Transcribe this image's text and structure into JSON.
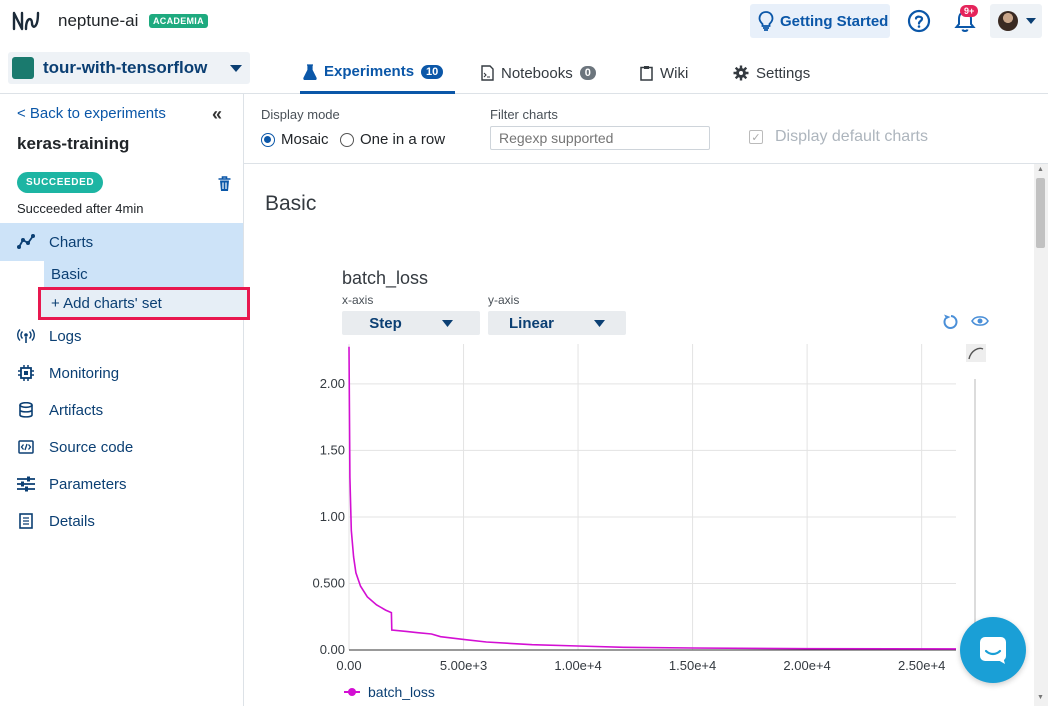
{
  "app": {
    "brand": "neptune-ai",
    "plan_badge": "ACADEMIA"
  },
  "header": {
    "getting_started": "Getting Started",
    "notifications_badge": "9+"
  },
  "project": {
    "name": "tour-with-tensorflow",
    "color": "#1a7a6e"
  },
  "tabs": [
    {
      "label": "Experiments",
      "count": "10",
      "active": true,
      "icon": "flask-icon"
    },
    {
      "label": "Notebooks",
      "count": "0",
      "active": false,
      "icon": "notebook-icon"
    },
    {
      "label": "Wiki",
      "active": false,
      "icon": "clipboard-icon"
    },
    {
      "label": "Settings",
      "active": false,
      "icon": "gear-icon"
    }
  ],
  "sidebar": {
    "back_link": "< Back to experiments",
    "experiment_name": "keras-training",
    "status": "SUCCEEDED",
    "status_text": "Succeeded after 4min",
    "charts_label": "Charts",
    "sub_items": [
      "Basic",
      "+ Add charts' set"
    ],
    "items": [
      {
        "label": "Logs",
        "icon": "antenna-icon"
      },
      {
        "label": "Monitoring",
        "icon": "chip-icon"
      },
      {
        "label": "Artifacts",
        "icon": "database-icon"
      },
      {
        "label": "Source code",
        "icon": "code-icon"
      },
      {
        "label": "Parameters",
        "icon": "sliders-icon"
      },
      {
        "label": "Details",
        "icon": "document-icon"
      }
    ]
  },
  "toolbar": {
    "display_mode_label": "Display mode",
    "mode_options": [
      "Mosaic",
      "One in a row"
    ],
    "selected_mode": "Mosaic",
    "filter_label": "Filter charts",
    "filter_placeholder": "Regexp supported",
    "default_charts_label": "Display default charts"
  },
  "main": {
    "section_title": "Basic",
    "chart": {
      "title": "batch_loss",
      "x_axis_label": "x-axis",
      "x_axis_value": "Step",
      "y_axis_label": "y-axis",
      "y_axis_value": "Linear"
    }
  },
  "chart_data": {
    "type": "line",
    "title": "batch_loss",
    "xlabel": "",
    "ylabel": "",
    "xlim": [
      0,
      26500
    ],
    "ylim": [
      0,
      2.3
    ],
    "x_ticks": [
      "0.00",
      "5.00e+3",
      "1.00e+4",
      "1.50e+4",
      "2.00e+4",
      "2.50e+4"
    ],
    "y_ticks": [
      "0.00",
      "0.500",
      "1.00",
      "1.50",
      "2.00"
    ],
    "grid": true,
    "legend_position": "bottom-left",
    "series": [
      {
        "name": "batch_loss",
        "color": "#d30fd3",
        "x": [
          0,
          40,
          100,
          200,
          300,
          500,
          800,
          1200,
          1600,
          1850,
          1870,
          2500,
          3000,
          3600,
          4000,
          5000,
          6000,
          8000,
          10000,
          12000,
          15000,
          20000,
          26500
        ],
        "y": [
          2.28,
          1.3,
          0.9,
          0.7,
          0.58,
          0.48,
          0.4,
          0.34,
          0.3,
          0.28,
          0.15,
          0.14,
          0.13,
          0.12,
          0.1,
          0.08,
          0.06,
          0.04,
          0.03,
          0.02,
          0.015,
          0.01,
          0.008
        ]
      }
    ]
  }
}
